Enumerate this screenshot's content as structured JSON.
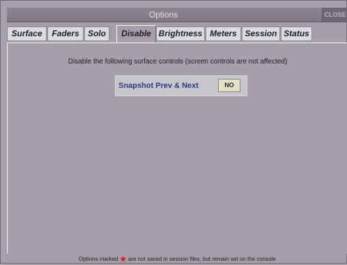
{
  "window": {
    "title": "Options",
    "close_label": "CLOSE"
  },
  "tabs": [
    {
      "label": "Surface",
      "active": false
    },
    {
      "label": "Faders",
      "active": false
    },
    {
      "label": "Solo",
      "active": false
    },
    {
      "label": "Disable",
      "active": true
    },
    {
      "label": "Brightness",
      "active": false
    },
    {
      "label": "Meters",
      "active": false
    },
    {
      "label": "Session",
      "active": false
    },
    {
      "label": "Status",
      "active": false
    }
  ],
  "disable_panel": {
    "description": "Disable the following surface controls (screen controls are not affected)",
    "controls": [
      {
        "label": "Snapshot Prev & Next",
        "value": "NO"
      }
    ]
  },
  "footer": {
    "text_before": "Options marked",
    "star_icon": "★",
    "text_after": "are not saved in session files, but remain set on the console"
  },
  "colors": {
    "background": "#a49fa9",
    "title_bar": "#7d7882",
    "control_label": "#2d3a82",
    "star": "#d8231f",
    "button_fill": "#e2e0c8"
  }
}
